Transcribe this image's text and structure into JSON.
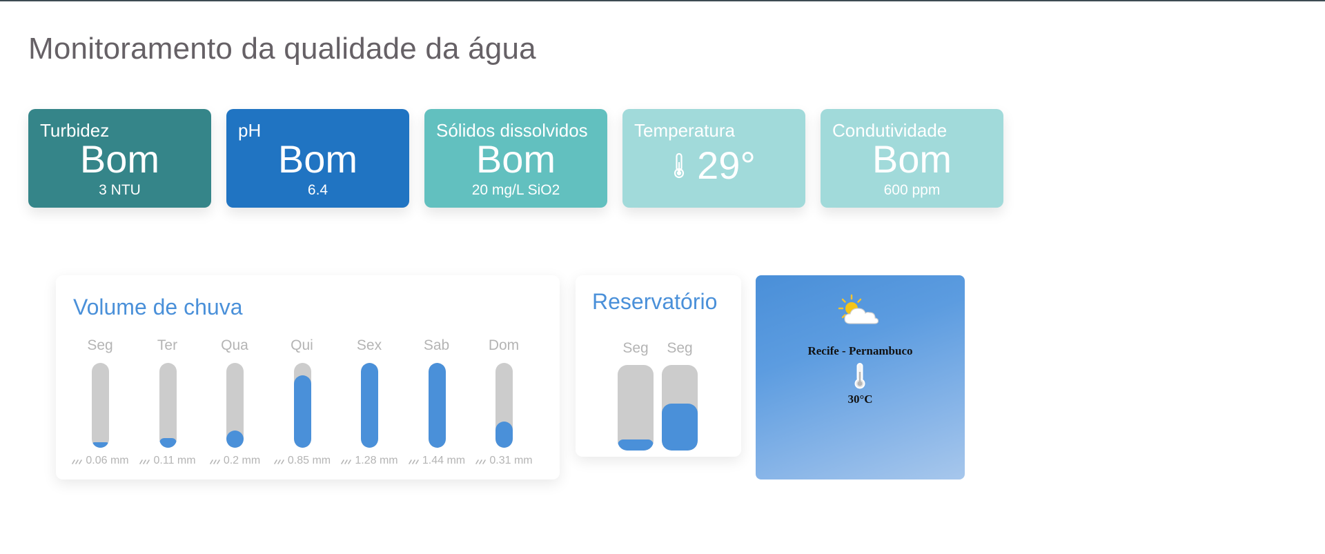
{
  "page": {
    "title": "Monitoramento da qualidade da água"
  },
  "cards": [
    {
      "label": "Turbidez",
      "status": "Bom",
      "value": "3 NTU",
      "color": "#358589"
    },
    {
      "label": "pH",
      "status": "Bom",
      "value": "6.4",
      "color": "#2074c2"
    },
    {
      "label": "Sólidos dissolvidos",
      "status": "Bom",
      "value": "20 mg/L SiO2",
      "color": "#62c0bf"
    },
    {
      "label": "Temperatura",
      "temp": "29°",
      "icon": "thermometer-icon",
      "color": "#a1dada"
    },
    {
      "label": "Condutividade",
      "status": "Bom",
      "value": "600 ppm",
      "color": "#a1dada"
    }
  ],
  "rain": {
    "title": "Volume de chuva",
    "icon": "rain-icon",
    "days": [
      {
        "day": "Seg",
        "mm": "0.06 mm",
        "level": 0.06
      },
      {
        "day": "Ter",
        "mm": "0.11 mm",
        "level": 0.11
      },
      {
        "day": "Qua",
        "mm": "0.2 mm",
        "level": 0.2
      },
      {
        "day": "Qui",
        "mm": "0.85 mm",
        "level": 0.85
      },
      {
        "day": "Sex",
        "mm": "1.28 mm",
        "level": 1.0
      },
      {
        "day": "Sab",
        "mm": "1.44 mm",
        "level": 1.0
      },
      {
        "day": "Dom",
        "mm": "0.31 mm",
        "level": 0.31
      }
    ]
  },
  "reservoir": {
    "title": "Reservatório",
    "bars": [
      {
        "label": "Seg",
        "level": 0.13
      },
      {
        "label": "Seg",
        "level": 0.55
      }
    ]
  },
  "weather": {
    "icon": "partly-cloudy-icon",
    "location": "Recife - Pernambuco",
    "thermo_icon": "thermometer-icon",
    "temperature": "30°C"
  }
}
